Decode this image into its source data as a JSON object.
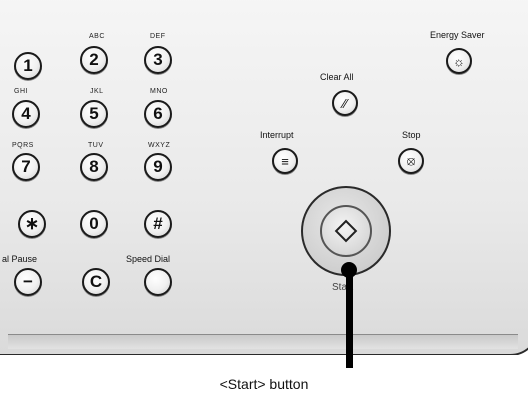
{
  "keypad": {
    "row1": [
      {
        "digit": "1",
        "letters": ""
      },
      {
        "digit": "2",
        "letters": "ABC"
      },
      {
        "digit": "3",
        "letters": "DEF"
      }
    ],
    "row2": [
      {
        "digit": "4",
        "letters": "GHI"
      },
      {
        "digit": "5",
        "letters": "JKL"
      },
      {
        "digit": "6",
        "letters": "MNO"
      }
    ],
    "row3": [
      {
        "digit": "7",
        "letters": "PQRS"
      },
      {
        "digit": "8",
        "letters": "TUV"
      },
      {
        "digit": "9",
        "letters": "WXYZ"
      }
    ],
    "row4": [
      {
        "digit": "∗"
      },
      {
        "digit": "0"
      },
      {
        "digit": "#"
      }
    ],
    "dial_pause_label": "al Pause",
    "dial_pause_glyph": "−",
    "clear_glyph": "C",
    "speed_dial_label": "Speed Dial"
  },
  "controls": {
    "energy_saver_label": "Energy Saver",
    "clear_all_label": "Clear All",
    "interrupt_label": "Interrupt",
    "stop_label": "Stop",
    "start_label": "Start"
  },
  "caption": "<Start> button",
  "icons": [
    "energy-saver-icon",
    "clear-all-icon",
    "interrupt-icon",
    "stop-icon",
    "start-diamond-icon"
  ]
}
